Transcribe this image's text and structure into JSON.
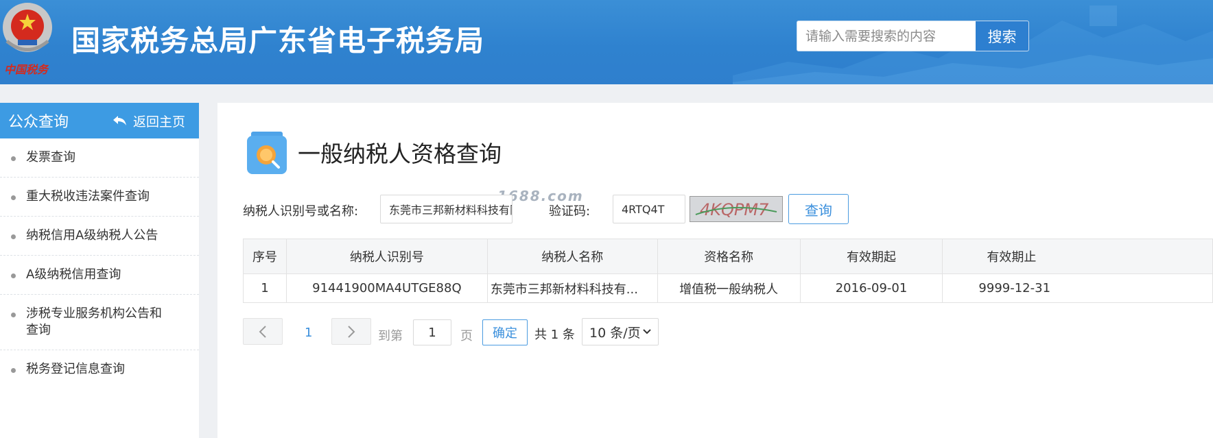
{
  "header": {
    "emblem_text": "中国税务",
    "site_title": "国家税务总局广东省电子税务局",
    "search": {
      "placeholder": "请输入需要搜索的内容",
      "button_label": "搜索"
    }
  },
  "sidebar": {
    "title": "公众查询",
    "back_label": "返回主页",
    "items": [
      {
        "label": "发票查询"
      },
      {
        "label": "重大税收违法案件查询"
      },
      {
        "label": "纳税信用A级纳税人公告"
      },
      {
        "label": "A级纳税信用查询"
      },
      {
        "label": "涉税专业服务机构公告和查询"
      },
      {
        "label": "税务登记信息查询"
      }
    ]
  },
  "main": {
    "title": "一般纳税人资格查询",
    "form": {
      "taxpayer_label": "纳税人识别号或名称:",
      "taxpayer_value": "东莞市三邦新材料科技有限公司",
      "captcha_label": "验证码:",
      "captcha_value": "4RTQ4T",
      "captcha_image_text": "4KQPM7",
      "query_button": "查询"
    },
    "watermark": "1688.com",
    "table": {
      "headers": [
        "序号",
        "纳税人识别号",
        "纳税人名称",
        "资格名称",
        "有效期起",
        "有效期止"
      ],
      "rows": [
        [
          "1",
          "91441900MA4UTGE88Q",
          "东莞市三邦新材料科技有...",
          "增值税一般纳税人",
          "2016-09-01",
          "9999-12-31"
        ]
      ]
    },
    "pagination": {
      "current_page": "1",
      "goto_label": "到第",
      "goto_value": "1",
      "page_unit": "页",
      "confirm_label": "确定",
      "total_label": "共 1 条",
      "page_size": "10 条/页"
    }
  },
  "colors": {
    "header_blue": "#2f82cf",
    "accent": "#3d9be3",
    "link_blue": "#3a8fdc"
  }
}
